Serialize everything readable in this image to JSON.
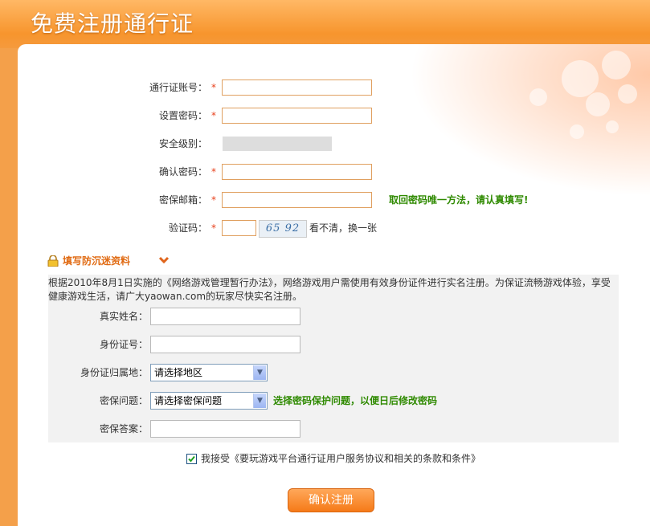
{
  "header": {
    "title": "免费注册通行证"
  },
  "form": {
    "account": {
      "label": "通行证账号：",
      "required": "*"
    },
    "password": {
      "label": "设置密码：",
      "required": "*"
    },
    "security_level": {
      "label": "安全级别："
    },
    "confirm_password": {
      "label": "确认密码：",
      "required": "*"
    },
    "email": {
      "label": "密保邮箱：",
      "required": "*",
      "tip": "取回密码唯一方法，请认真填写!"
    },
    "captcha": {
      "label": "验证码：",
      "required": "*",
      "image_text": "65 92",
      "refresh_link": "看不清，换一张"
    }
  },
  "anti_addiction": {
    "heading": "填写防沉迷资料",
    "description": "根据2010年8月1日实施的《网络游戏管理暂行办法》，网络游戏用户需使用有效身份证件进行实名注册。为保证流畅游戏体验，享受健康游戏生活，请广大yaowan.com的玩家尽快实名注册。",
    "real_name": {
      "label": "真实姓名："
    },
    "id_number": {
      "label": "身份证号："
    },
    "id_region": {
      "label": "身份证归属地：",
      "selected": "请选择地区"
    },
    "security_question": {
      "label": "密保问题：",
      "selected": "请选择密保问题",
      "tip": "选择密码保护问题，以便日后修改密码"
    },
    "security_answer": {
      "label": "密保答案："
    }
  },
  "agreement": {
    "text": "我接受《要玩游戏平台通行证用户服务协议和相关的条款和条件》",
    "checked": true
  },
  "submit": {
    "label": "确认注册"
  },
  "colors": {
    "accent": "#f7952d",
    "required": "#e8401c",
    "tip": "#2f8a00"
  }
}
